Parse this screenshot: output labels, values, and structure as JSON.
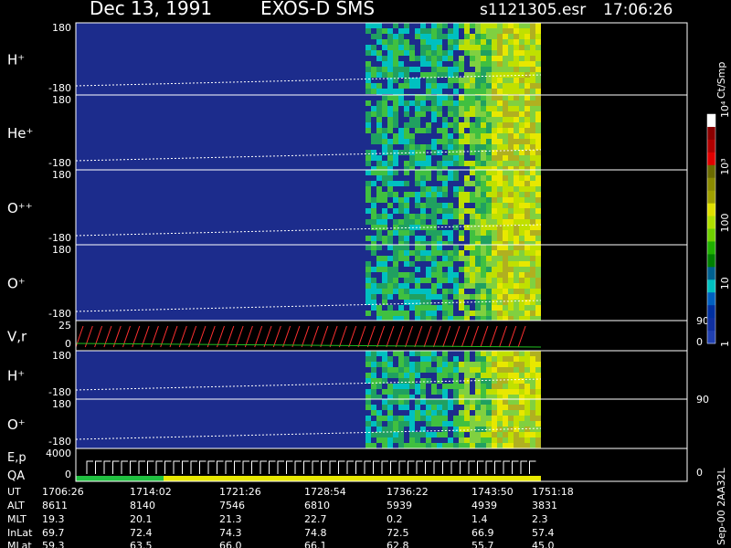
{
  "header": {
    "date": "Dec 13, 1991",
    "instrument": "EXOS-D SMS",
    "file": "s1121305.esr",
    "time": "17:06:26"
  },
  "colorbar": {
    "unit": "Ct/Smp",
    "tick_labels": [
      "10⁴",
      "10³",
      "100",
      "10",
      "1"
    ],
    "tick_values": [
      10000,
      1000,
      100,
      10,
      1
    ],
    "colors": [
      "#ffffff",
      "#8b0000",
      "#b00000",
      "#e00000",
      "#6b6b00",
      "#8a8a00",
      "#a0a000",
      "#e0e000",
      "#b0e000",
      "#70d000",
      "#20b000",
      "#008000",
      "#006090",
      "#00c0c0",
      "#0060c0",
      "#0030a0",
      "#1030a0",
      "#2040b0"
    ]
  },
  "panels": [
    {
      "species": "H⁺",
      "top": "180",
      "bottom": "-180"
    },
    {
      "species": "He⁺",
      "top": "180",
      "bottom": "-180"
    },
    {
      "species": "O⁺⁺",
      "top": "180",
      "bottom": "-180"
    },
    {
      "species": "O⁺",
      "top": "180",
      "bottom": "-180"
    },
    {
      "species": "V,r",
      "top": "25",
      "bottom": "0",
      "right_top": "90",
      "right_bottom": "0"
    },
    {
      "species": "H⁺",
      "top": "180",
      "bottom": "-180"
    },
    {
      "species": "O⁺",
      "top": "180",
      "bottom": "-180",
      "right_top": "90"
    },
    {
      "species": "E,p",
      "species2": "QA",
      "top": "4000",
      "bottom": "0",
      "right_bottom": "0"
    }
  ],
  "footer": {
    "row_labels": [
      "UT",
      "ALT",
      "MLT",
      "InLat",
      "MLat"
    ],
    "columns": [
      [
        "1706:26",
        "8611",
        "19.3",
        "69.7",
        "59.3"
      ],
      [
        "1714:02",
        "8140",
        "20.1",
        "72.4",
        "63.5"
      ],
      [
        "1721:26",
        "7546",
        "21.3",
        "74.3",
        "66.0"
      ],
      [
        "1728:54",
        "6810",
        "22.7",
        "74.8",
        "66.1"
      ],
      [
        "1736:22",
        "5939",
        "0.2",
        "72.5",
        "62.8"
      ],
      [
        "1743:50",
        "4939",
        "1.4",
        "66.9",
        "55.7"
      ],
      [
        "1751:18",
        "3831",
        "2.3",
        "57.4",
        "45.0"
      ]
    ]
  },
  "side_note": "Sep-00  2AA32L",
  "chart_data": {
    "type": "heatmap",
    "title": "Dec 13, 1991   EXOS-D SMS",
    "x_ticks": [
      "1706:26",
      "1714:02",
      "1721:26",
      "1728:54",
      "1736:22",
      "1743:50",
      "1751:18"
    ],
    "ion_panels": [
      "H⁺",
      "He⁺",
      "O⁺⁺",
      "O⁺",
      "H⁺",
      "O⁺"
    ],
    "ylim_pitch": [
      -180,
      180
    ],
    "ylim_vr": [
      0,
      25
    ],
    "ylim_ep": [
      0,
      4000
    ],
    "color_scale": "log",
    "color_range": [
      1,
      10000
    ],
    "color_unit": "Ct/Smp"
  }
}
